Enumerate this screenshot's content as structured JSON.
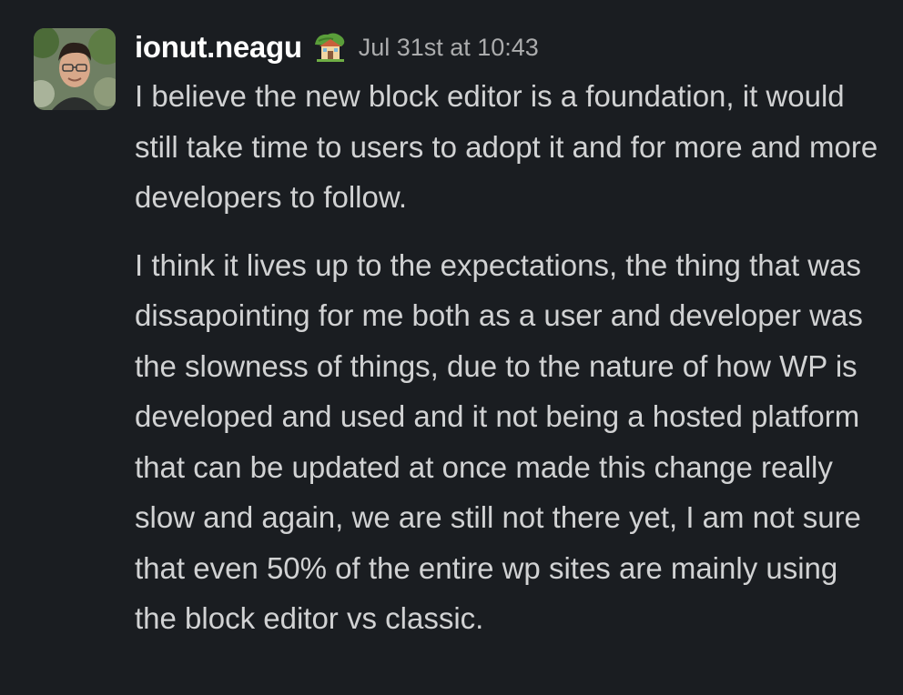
{
  "message": {
    "author": "ionut.neagu",
    "status_emoji": "house-with-garden-icon",
    "timestamp": "Jul 31st at 10:43",
    "paragraphs": [
      "I believe the new block editor is a foundation, it would still take time to users to adopt it and for more and more developers to follow.",
      "I think it lives up to the expectations, the thing that was dissapointing for me both as a user and developer was the slowness of things, due to the nature of how WP is developed and used and it not being a hosted platform that can be updated at once made this change really slow and again, we are still not there yet, I am not sure that even 50% of the entire wp sites are mainly using the block editor vs classic."
    ]
  },
  "colors": {
    "background": "#1a1d21",
    "author": "#ffffff",
    "text": "#d1d2d3",
    "timestamp": "#abacad"
  }
}
